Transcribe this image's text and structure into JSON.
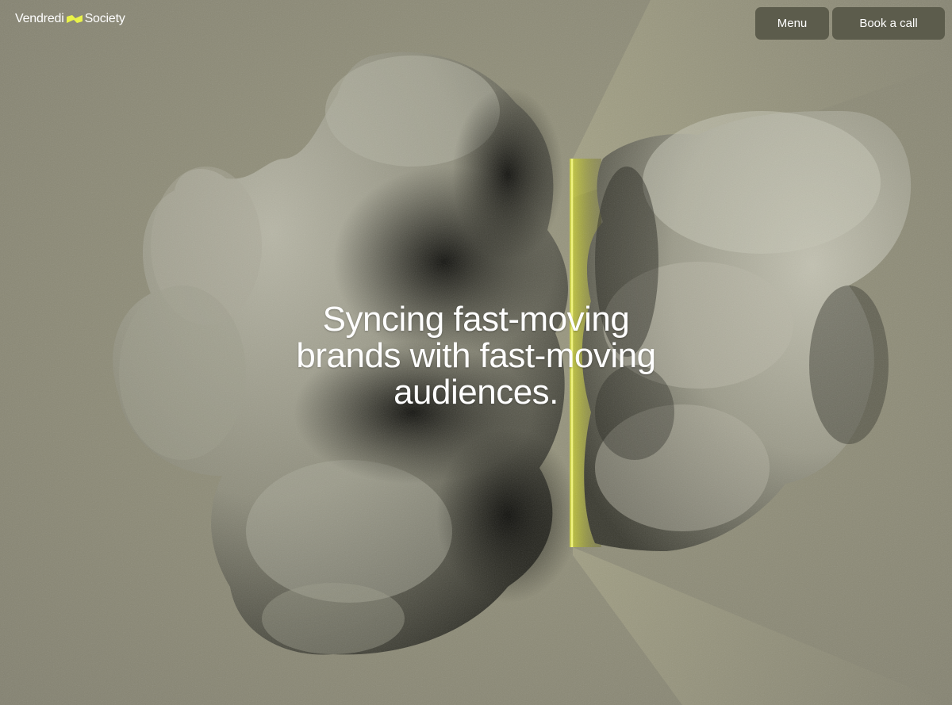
{
  "brand": {
    "name_left": "Vendredi",
    "name_right": "Society",
    "accent_color": "#e9f249"
  },
  "nav": {
    "menu_label": "Menu",
    "cta_label": "Book a call"
  },
  "hero": {
    "headline_line1": "Syncing fast-moving",
    "headline_line2": "brands with fast-moving",
    "headline_line3": "audiences."
  },
  "colors": {
    "background": "#8d8b79",
    "button_bg": "#5c5c4c",
    "rock": "#a8a796",
    "glow": "#d9e02a"
  }
}
